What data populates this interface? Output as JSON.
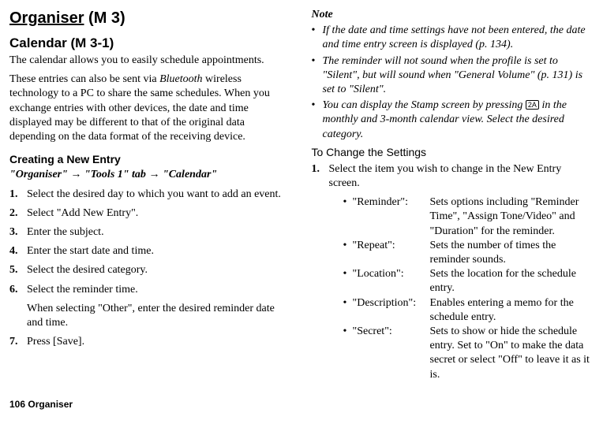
{
  "left": {
    "h1_main": "Organiser",
    "h1_suffix": " (M 3)",
    "h2": "Calendar (M 3-1)",
    "intro": "The calendar allows you to easily schedule appointments.",
    "para2a": "These entries can also be sent via ",
    "para2b": "Bluetooth",
    "para2c": " wireless technology to a PC to share the same schedules. When you exchange entries with other devices, the date and time displayed may be different to that of the original data depending on the data format of the receiving device.",
    "create_heading": "Creating a New Entry",
    "nav1": "\"Organiser\"",
    "navarrow": " → ",
    "nav2": "\"Tools 1\" tab",
    "nav3": "\"Calendar\"",
    "steps": [
      "Select the desired day to which you want to add an event.",
      "Select \"Add New Entry\".",
      "Enter the subject.",
      "Enter the start date and time.",
      "Select the desired category.",
      "Select the reminder time.",
      "Press [Save]."
    ],
    "step6_extra": "When selecting \"Other\", enter the desired reminder date and time."
  },
  "right": {
    "note_label": "Note",
    "notes": [
      "If the date and time settings have not been entered, the date and time entry screen is displayed (p. 134).",
      "The reminder will not sound when the profile is set to \"Silent\", but will sound when \"General Volume\" (p. 131) is set to \"Silent\"."
    ],
    "note3a": "You can display the Stamp screen by pressing ",
    "note3_icon": "2A",
    "note3b": " in the monthly and 3-month calendar view. Select the desired category.",
    "change_heading": "To Change the Settings",
    "change_step_num": "1.",
    "change_step": "Select the item you wish to change in the New Entry screen.",
    "settings": [
      {
        "k": "\"Reminder\":",
        "v": "Sets options including \"Reminder Time\", \"Assign Tone/Video\" and \"Duration\" for the reminder."
      },
      {
        "k": "\"Repeat\":",
        "v": "Sets the number of times the reminder sounds."
      },
      {
        "k": "\"Location\":",
        "v": "Sets the location for the schedule entry."
      },
      {
        "k": "\"Description\":",
        "v": "Enables entering a memo for the schedule entry."
      },
      {
        "k": "\"Secret\":",
        "v": "Sets to show or hide the schedule entry. Set to \"On\" to make the data secret or select \"Off\" to leave it as it is."
      }
    ]
  },
  "footer": "106   Organiser"
}
